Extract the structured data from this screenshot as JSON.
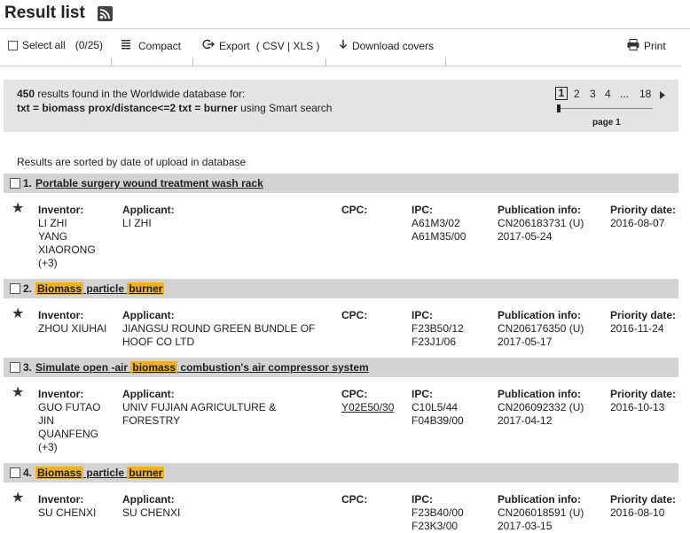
{
  "header": {
    "title": "Result list"
  },
  "toolbar": {
    "select_all": "Select all",
    "select_count": "(0/25)",
    "compact": "Compact",
    "export": "Export",
    "export_formats": "( CSV | XLS )",
    "download_covers": "Download covers",
    "print": "Print"
  },
  "summary": {
    "count": "450",
    "line1_rest": " results found in the Worldwide database for:",
    "query": "txt = biomass prox/distance<=2 txt = burner",
    "line2_rest": " using Smart search"
  },
  "pager": {
    "current": "1",
    "pages": [
      "2",
      "3",
      "4",
      "...",
      "18"
    ],
    "label": "page 1"
  },
  "sort_note": "Results are sorted by date of upload in database",
  "labels": {
    "inventor": "Inventor:",
    "applicant": "Applicant:",
    "cpc": "CPC:",
    "ipc": "IPC:",
    "publication": "Publication info:",
    "priority": "Priority date:"
  },
  "results": [
    {
      "num": "1.",
      "title_parts": [
        {
          "t": "Portable surgery wound treatment wash rack",
          "h": false
        }
      ],
      "inventor": [
        "LI ZHI",
        "YANG",
        "XIAORONG",
        "(+3)"
      ],
      "applicant": [
        "LI ZHI"
      ],
      "cpc": [],
      "ipc": [
        "A61M3/02",
        "A61M35/00"
      ],
      "publication": [
        "CN206183731 (U)",
        "2017-05-24"
      ],
      "priority": "2016-08-07"
    },
    {
      "num": "2.",
      "title_parts": [
        {
          "t": "Biomass",
          "h": true
        },
        {
          "t": " particle ",
          "h": false
        },
        {
          "t": "burner",
          "h": true
        }
      ],
      "inventor": [
        "ZHOU XIUHAI"
      ],
      "applicant": [
        "JIANGSU ROUND GREEN BUNDLE OF",
        "HOOF CO LTD"
      ],
      "cpc": [],
      "ipc": [
        "F23B50/12",
        "F23J1/06"
      ],
      "publication": [
        "CN206176350 (U)",
        "2017-05-17"
      ],
      "priority": "2016-11-24"
    },
    {
      "num": "3.",
      "title_parts": [
        {
          "t": "Simulate open -air ",
          "h": false
        },
        {
          "t": "biomass",
          "h": true
        },
        {
          "t": " combustion's air compressor system",
          "h": false
        }
      ],
      "inventor": [
        "GUO FUTAO",
        "JIN",
        "QUANFENG",
        "(+3)"
      ],
      "applicant": [
        "UNIV FUJIAN AGRICULTURE &",
        "FORESTRY"
      ],
      "cpc": [
        "Y02E50/30"
      ],
      "ipc": [
        "C10L5/44",
        "F04B39/00"
      ],
      "publication": [
        "CN206092332 (U)",
        "2017-04-12"
      ],
      "priority": "2016-10-13"
    },
    {
      "num": "4.",
      "title_parts": [
        {
          "t": "Biomass",
          "h": true
        },
        {
          "t": " particle ",
          "h": false
        },
        {
          "t": "burner",
          "h": true
        }
      ],
      "inventor": [
        "SU CHENXI"
      ],
      "applicant": [
        "SU CHENXI"
      ],
      "cpc": [],
      "ipc": [
        "F23B40/00",
        "F23K3/00"
      ],
      "publication": [
        "CN206018591 (U)",
        "2017-03-15"
      ],
      "priority": "2016-08-10"
    }
  ]
}
